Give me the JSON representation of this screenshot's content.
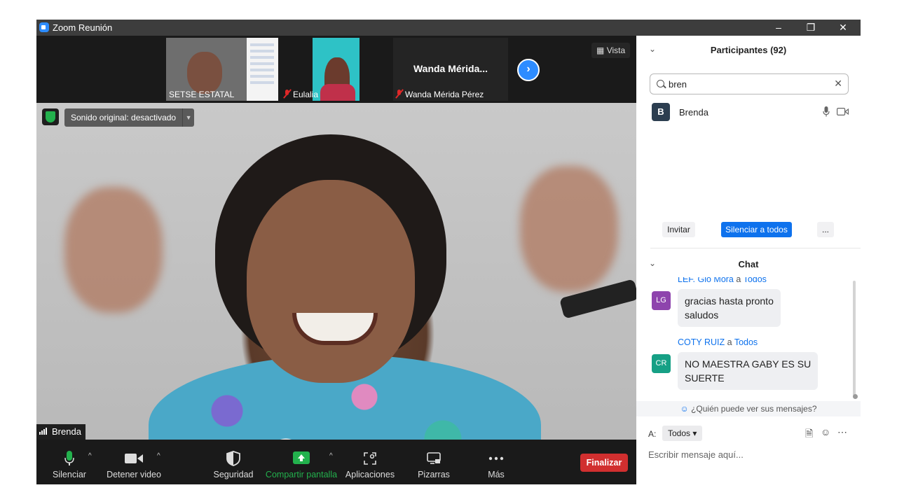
{
  "window": {
    "title": "Zoom Reunión"
  },
  "video": {
    "thumbnails": [
      {
        "name": "SETSE ESTATAL",
        "muted": false
      },
      {
        "name": "Eulalia",
        "muted": true
      },
      {
        "name": "Wanda Mérida Pérez",
        "display_name": "Wanda  Mérida...",
        "muted": true
      }
    ],
    "view_label": "Vista",
    "sound_label": "Sonido original: desactivado",
    "active_speaker": "Brenda"
  },
  "toolbar": {
    "mute": "Silenciar",
    "stop_video": "Detener video",
    "security": "Seguridad",
    "share": "Compartir pantalla",
    "apps": "Aplicaciones",
    "whiteboards": "Pizarras",
    "more": "Más",
    "end": "Finalizar"
  },
  "participants": {
    "title": "Participantes (92)",
    "search_value": "bren",
    "list": [
      {
        "initial": "B",
        "name": "Brenda"
      }
    ],
    "invite": "Invitar",
    "mute_all": "Silenciar a todos",
    "more": "..."
  },
  "chat": {
    "title": "Chat",
    "to_word": "a",
    "messages": [
      {
        "sender": "LEF. Glo Mora",
        "to": "Todos",
        "initials": "LG",
        "color": "#8e44ad",
        "lines": [
          "gracias hasta pronto",
          "saludos"
        ]
      },
      {
        "sender": "COTY RUIZ",
        "to": "Todos",
        "initials": "CR",
        "color": "#16a085",
        "lines": [
          "NO MAESTRA GABY ES SU",
          "SUERTE"
        ]
      }
    ],
    "who_can_see": "¿Quién puede ver sus mensajes?",
    "to_label": "A:",
    "recipient": "Todos",
    "placeholder": "Escribir mensaje aquí..."
  },
  "colors": {
    "accent": "#0e72ed",
    "end_red": "#d12f2f",
    "share_green": "#23b14d"
  }
}
